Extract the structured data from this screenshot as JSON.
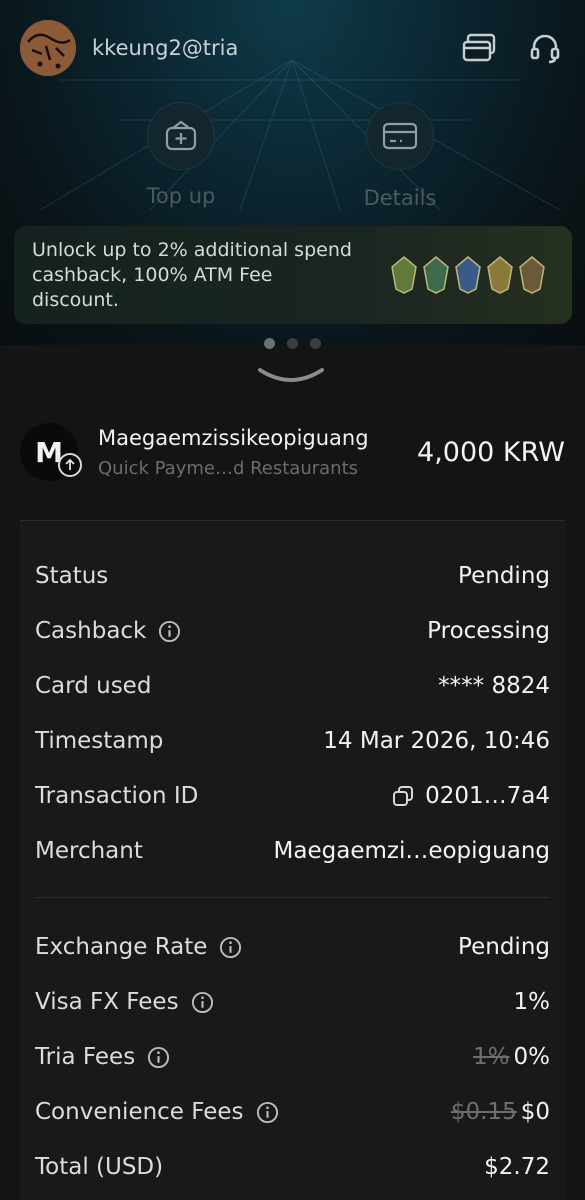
{
  "header": {
    "username": "kkeung2@tria",
    "icons": [
      "card-stack-icon",
      "headset-icon"
    ]
  },
  "actions": [
    {
      "label": "Top up",
      "icon": "wallet-plus-icon"
    },
    {
      "label": "Details",
      "icon": "card-icon"
    }
  ],
  "promo": {
    "text": "Unlock up to 2% additional spend cashback, 100% ATM Fee discount.",
    "badge_colors": [
      "#5f7a3a",
      "#3c6a4a",
      "#3a5a8a",
      "#8a7a3a",
      "#6a5a3a"
    ]
  },
  "transaction": {
    "avatar_letter": "M",
    "merchant_name": "Maegaemzissikeopiguang",
    "subtitle": "Quick Payme…d Restaurants",
    "amount": "4,000 KRW"
  },
  "details": [
    {
      "label": "Status",
      "value": "Pending",
      "info": false
    },
    {
      "label": "Cashback",
      "value": "Processing",
      "info": true
    },
    {
      "label": "Card used",
      "value": "**** 8824",
      "info": false
    },
    {
      "label": "Timestamp",
      "value": "14 Mar 2026, 10:46",
      "info": false
    },
    {
      "label": "Transaction ID",
      "value": "0201…7a4",
      "info": false,
      "copy": true
    },
    {
      "label": "Merchant",
      "value": "Maegaemzi…eopiguang",
      "info": false
    }
  ],
  "fees": [
    {
      "label": "Exchange Rate",
      "value": "Pending",
      "info": true
    },
    {
      "label": "Visa FX Fees",
      "value": "1%",
      "info": true
    },
    {
      "label": "Tria Fees",
      "old": "1%",
      "value": "0%",
      "info": true
    },
    {
      "label": "Convenience Fees",
      "old": "$0.15",
      "value": "$0",
      "info": true
    },
    {
      "label": "Total (USD)",
      "value": "$2.72",
      "info": false
    }
  ]
}
